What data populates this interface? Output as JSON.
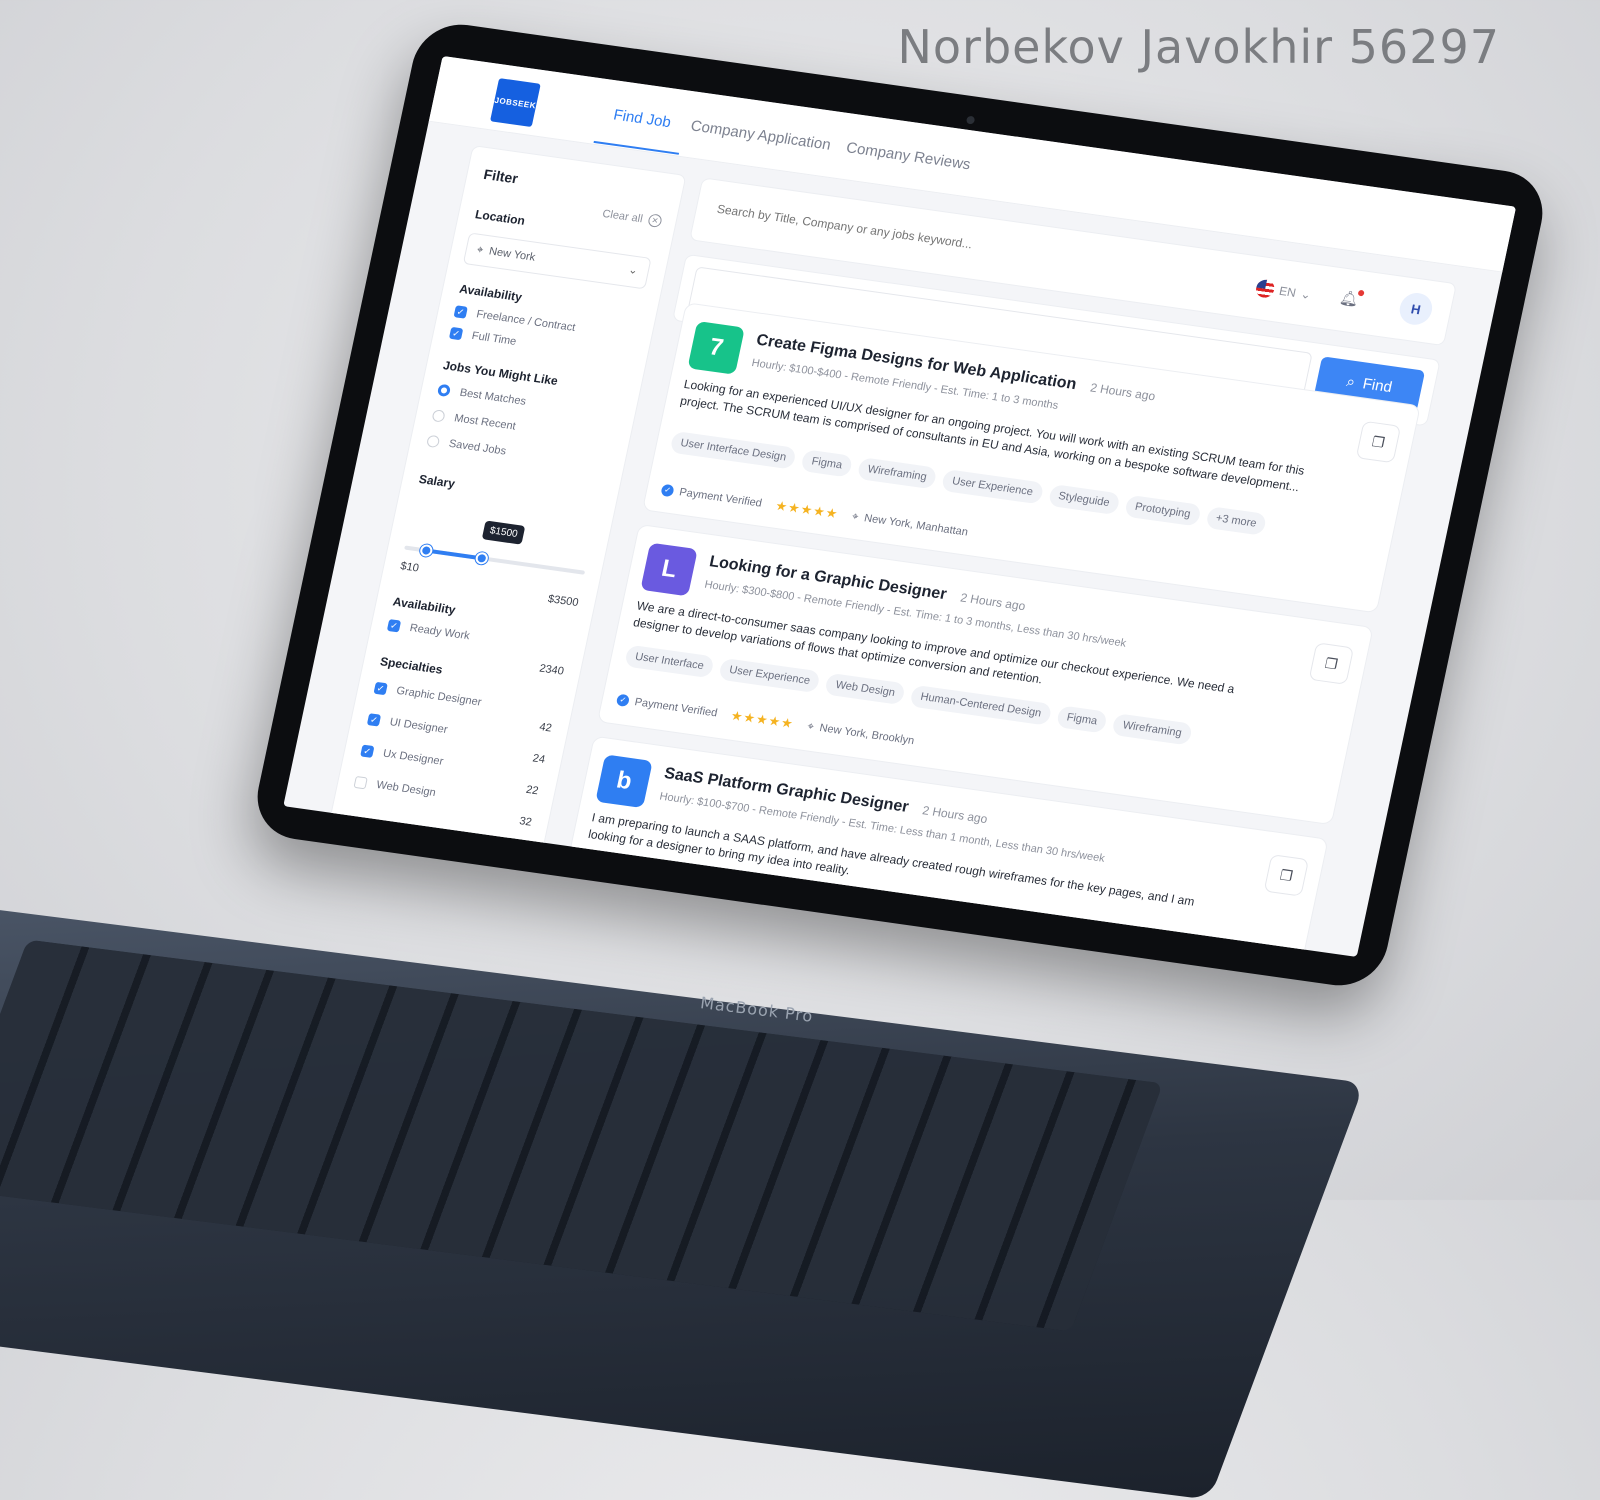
{
  "watermark": "Norbekov Javokhir 56297",
  "device_label": "MacBook Pro",
  "app": {
    "logo_text": "JOBSEEK",
    "tabs": [
      "Find Job",
      "Company Application",
      "Company Reviews"
    ]
  },
  "filter": {
    "title": "Filter",
    "clear_all": "Clear all",
    "location_label": "Location",
    "location_value": "New York",
    "availability_label": "Availability",
    "availability_options": [
      "Freelance / Contract",
      "Full Time"
    ],
    "jobs_like_label": "Jobs You Might Like",
    "jobs_like_options": [
      "Best Matches",
      "Most Recent",
      "Saved Jobs"
    ],
    "salary_label": "Salary",
    "salary_min": "$10",
    "salary_max": "$3500",
    "salary_tip": "$1500",
    "salary_range_fraction": [
      0.12,
      0.43
    ],
    "availability2_label": "Availability",
    "availability2_option": "Ready Work",
    "availability2_count": "2340",
    "specialties_label": "Specialties",
    "specialties": [
      {
        "label": "Graphic Designer",
        "count": "42",
        "checked": true
      },
      {
        "label": "UI Designer",
        "count": "24",
        "checked": true
      },
      {
        "label": "Ux Designer",
        "count": "22",
        "checked": true
      },
      {
        "label": "Web Design",
        "count": "32",
        "checked": false
      }
    ]
  },
  "header": {
    "search_placeholder": "Search by Title, Company or any jobs keyword...",
    "lang": "EN",
    "avatar": "H"
  },
  "find_button": "Find",
  "jobs": [
    {
      "title": "Create Figma Designs for Web Application",
      "time": "2 Hours ago",
      "meta": "Hourly: $100-$400 - Remote Friendly - Est. Time: 1 to 3 months",
      "desc": "Looking for an experienced UI/UX designer for an ongoing project. You will work with an existing SCRUM team for this project. The SCRUM team is comprised of consultants in EU and Asia, working on a bespoke software development...",
      "tags": [
        "User Interface Design",
        "Figma",
        "Wireframing",
        "User Experience",
        "Styleguide",
        "Prototyping",
        "+3 more"
      ],
      "verified": "Payment Verified",
      "location": "New York, Manhattan",
      "logo_color": "#17c38a",
      "logo_glyph": "7"
    },
    {
      "title": "Looking for a Graphic Designer",
      "time": "2 Hours ago",
      "meta": "Hourly: $300-$800 - Remote Friendly - Est. Time: 1 to 3 months, Less than 30 hrs/week",
      "desc": "We are a direct-to-consumer saas company looking to improve and optimize our checkout experience. We need a designer to develop variations of flows that optimize conversion and retention.",
      "tags": [
        "User Interface",
        "User Experience",
        "Web Design",
        "Human-Centered Design",
        "Figma",
        "Wireframing"
      ],
      "verified": "Payment Verified",
      "location": "New York, Brooklyn",
      "logo_color": "#6a5ae0",
      "logo_glyph": "L"
    },
    {
      "title": "SaaS Platform Graphic Designer",
      "time": "2 Hours ago",
      "meta": "Hourly: $100-$700 - Remote Friendly - Est. Time: Less than 1 month, Less than 30 hrs/week",
      "desc": "I am preparing to launch a SAAS platform, and have already created rough wireframes for the key pages, and I am looking for a designer to bring my idea into reality.",
      "logo_color": "#2f7ef2",
      "logo_glyph": "b"
    }
  ]
}
